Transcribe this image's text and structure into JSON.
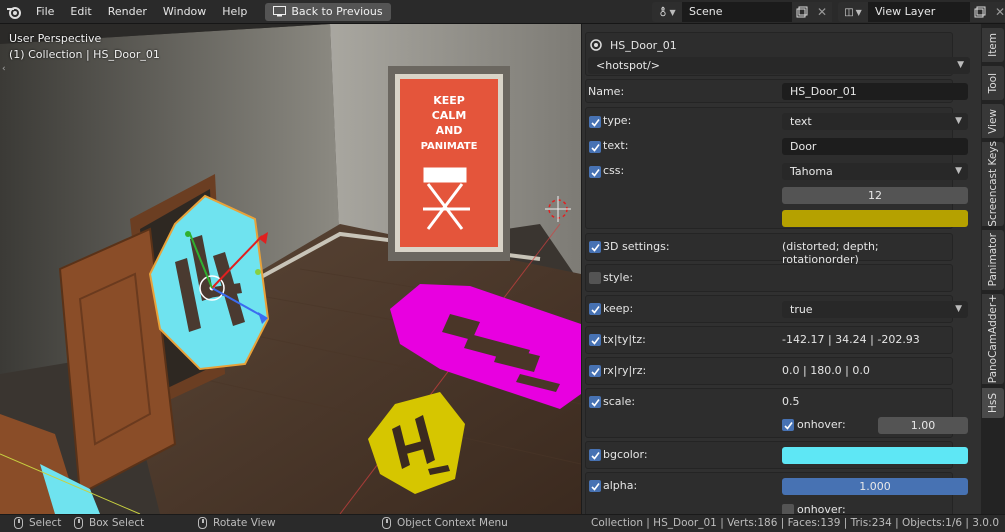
{
  "menu": [
    "File",
    "Edit",
    "Render",
    "Window",
    "Help"
  ],
  "back_button": "Back to Previous",
  "scene": {
    "name": "Scene",
    "view_layer": "View Layer"
  },
  "viewport": {
    "mode": "User Perspective",
    "context": "(1) Collection | HS_Door_01",
    "poster_text": "KEEP CALM AND PANIMATE",
    "chair_text": "PANIMATE"
  },
  "panel": {
    "object_name": "HS_Door_01",
    "tag": "<hotspot/>",
    "name_label": "Name:",
    "name_value": "HS_Door_01",
    "type_label": "type:",
    "type_value": "text",
    "text_label": "text:",
    "text_value": "Door",
    "css_label": "css:",
    "css_value": "Tahoma",
    "css_size": "12",
    "css_color": "#b5a100",
    "settings3d_label": "3D settings:",
    "settings3d_value": "(distorted; depth; rotationorder)",
    "style_label": "style:",
    "keep_label": "keep:",
    "keep_value": "true",
    "txyz_label": "tx|ty|tz:",
    "txyz_value": "-142.17 | 34.24 | -202.93",
    "rxyz_label": "rx|ry|rz:",
    "rxyz_value": "0.0 | 180.0 | 0.0",
    "scale_label": "scale:",
    "scale_value": "0.5",
    "onhover_label": "onhover:",
    "onhover_value": "1.00",
    "bgcolor_label": "bgcolor:",
    "bgcolor_value": "#5ee7f5",
    "alpha_label": "alpha:",
    "alpha_value": "1.000",
    "alpha_onhover_label": "onhover:"
  },
  "tabs": [
    "Item",
    "Tool",
    "View",
    "Screencast Keys",
    "Panimator",
    "PanoCamAdder+",
    "HsS"
  ],
  "active_tab": "HsS",
  "status": {
    "select": "Select",
    "box_select": "Box Select",
    "rotate": "Rotate View",
    "context_menu": "Object Context Menu",
    "stats": "Collection | HS_Door_01 | Verts:186 | Faces:139 | Tris:234 | Objects:1/6 | 3.0.0"
  },
  "colors": {
    "accent": "#4772b3",
    "magenta_hotspot": "#e800e0",
    "yellow_hotspot": "#d6c600",
    "cyan_hotspot": "#6fe3ef"
  }
}
